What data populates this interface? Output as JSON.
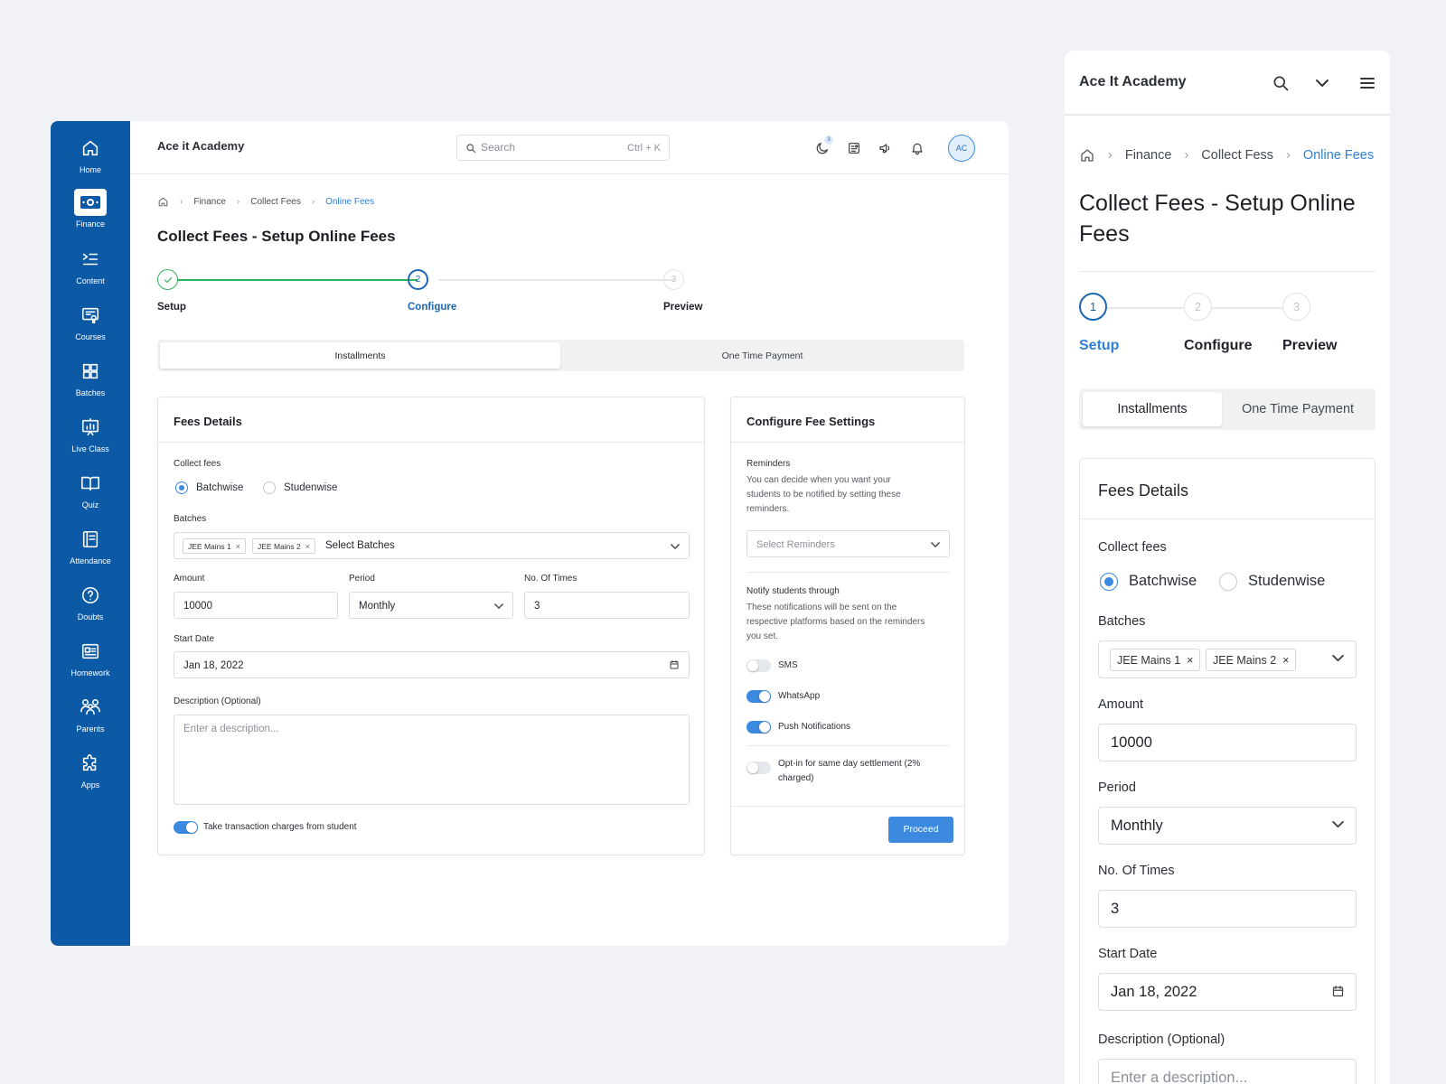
{
  "desktop": {
    "sidebar": [
      {
        "label": "Home",
        "icon": "home-icon"
      },
      {
        "label": "Finance",
        "icon": "finance-icon",
        "active": true
      },
      {
        "label": "Content",
        "icon": "content-icon"
      },
      {
        "label": "Courses",
        "icon": "courses-icon"
      },
      {
        "label": "Batches",
        "icon": "batches-icon"
      },
      {
        "label": "Live Class",
        "icon": "live-class-icon"
      },
      {
        "label": "Quiz",
        "icon": "quiz-icon"
      },
      {
        "label": "Attendance",
        "icon": "attendance-icon"
      },
      {
        "label": "Doubts",
        "icon": "doubts-icon"
      },
      {
        "label": "Homework",
        "icon": "homework-icon"
      },
      {
        "label": "Parents",
        "icon": "parents-icon"
      },
      {
        "label": "Apps",
        "icon": "apps-icon"
      }
    ],
    "header": {
      "title": "Ace it Academy",
      "search_placeholder": "Search",
      "search_shortcut": "Ctrl + K",
      "notification_count": "3",
      "avatar": "AC"
    },
    "breadcrumb": {
      "items": [
        "Finance",
        "Collect Fees"
      ],
      "current": "Online Fees"
    },
    "page_title": "Collect Fees - Setup Online Fees",
    "steps": [
      {
        "num": "1",
        "label": "Setup",
        "state": "done"
      },
      {
        "num": "2",
        "label": "Configure",
        "state": "active"
      },
      {
        "num": "3",
        "label": "Preview",
        "state": "pending"
      }
    ],
    "tabs": [
      "Installments",
      "One Time Payment"
    ],
    "fees_details": {
      "title": "Fees Details",
      "collect_label": "Collect fees",
      "options": [
        "Batchwise",
        "Studenwise"
      ],
      "batches_label": "Batches",
      "batches": [
        "JEE Mains 1",
        "JEE Mains 2"
      ],
      "batches_placeholder": "Select Batches",
      "amount_label": "Amount",
      "amount": "10000",
      "period_label": "Period",
      "period": "Monthly",
      "times_label": "No. Of Times",
      "times": "3",
      "start_label": "Start Date",
      "start": "Jan 18, 2022",
      "desc_label": "Description (Optional)",
      "desc_placeholder": "Enter a description...",
      "transaction_toggle": "Take transaction charges from student"
    },
    "settings": {
      "title": "Configure Fee Settings",
      "reminders_label": "Reminders",
      "reminders_help": "You can decide when you want your students to be notified by setting these reminders.",
      "reminders_placeholder": "Select Reminders",
      "notify_label": "Notify students through",
      "notify_help": "These notifications will be sent on the respective platforms based on the reminders you set.",
      "channels": [
        {
          "label": "SMS",
          "on": false
        },
        {
          "label": "WhatsApp",
          "on": true
        },
        {
          "label": "Push Notifications",
          "on": true
        }
      ],
      "settlement": "Opt-in for same day settlement (2% charged)",
      "proceed": "Proceed"
    }
  },
  "mobile": {
    "header_title": "Ace It Academy",
    "breadcrumb": {
      "items": [
        "Finance",
        "Collect Fess"
      ],
      "current": "Online Fees"
    },
    "page_title": "Collect Fees - Setup Online Fees",
    "steps": [
      {
        "num": "1",
        "label": "Setup",
        "state": "active"
      },
      {
        "num": "2",
        "label": "Configure",
        "state": "pending"
      },
      {
        "num": "3",
        "label": "Preview",
        "state": "pending"
      }
    ],
    "tabs": [
      "Installments",
      "One Time Payment"
    ],
    "card_title": "Fees Details",
    "collect_label": "Collect fees",
    "options": [
      "Batchwise",
      "Studenwise"
    ],
    "batches_label": "Batches",
    "batches": [
      "JEE Mains 1",
      "JEE Mains 2"
    ],
    "amount_label": "Amount",
    "amount": "10000",
    "period_label": "Period",
    "period": "Monthly",
    "times_label": "No. Of Times",
    "times": "3",
    "start_label": "Start Date",
    "start": "Jan 18, 2022",
    "desc_label": "Description (Optional)",
    "desc_placeholder": "Enter a description..."
  },
  "colors": {
    "primary": "#0c5aa6",
    "accent": "#3b8ae0",
    "success": "#2fb35a",
    "background": "#f0f2f5"
  }
}
